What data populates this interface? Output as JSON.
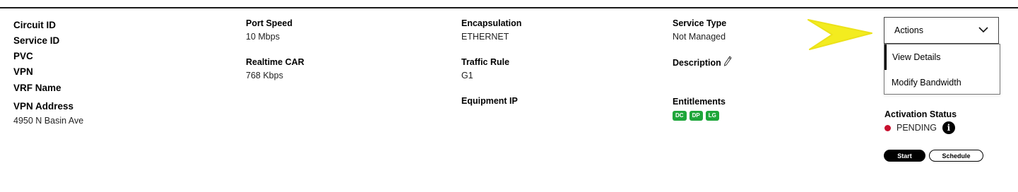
{
  "col1": {
    "circuit_id_label": "Circuit ID",
    "service_id_label": "Service ID",
    "pvc_label": "PVC",
    "vpn_label": "VPN",
    "vrf_name_label": "VRF Name",
    "vpn_address_label": "VPN Address",
    "vpn_address_value": "4950 N Basin Ave"
  },
  "col2": {
    "port_speed_label": "Port Speed",
    "port_speed_value": "10 Mbps",
    "realtime_car_label": "Realtime CAR",
    "realtime_car_value": "768 Kbps"
  },
  "col3": {
    "encapsulation_label": "Encapsulation",
    "encapsulation_value": "ETHERNET",
    "traffic_rule_label": "Traffic Rule",
    "traffic_rule_value": "G1",
    "equipment_ip_label": "Equipment IP"
  },
  "col4": {
    "service_type_label": "Service Type",
    "service_type_value": "Not Managed",
    "description_label": "Description",
    "entitlements_label": "Entitlements",
    "entitlements": [
      "DC",
      "DP",
      "LG"
    ]
  },
  "actions": {
    "label": "Actions",
    "menu": [
      "View Details",
      "Modify Bandwidth"
    ]
  },
  "activation": {
    "label": "Activation Status",
    "status": "PENDING",
    "info_glyph": "i",
    "start_label": "Start",
    "schedule_label": "Schedule"
  },
  "colors": {
    "badge_green": "#1ea63a",
    "status_red": "#c8102e",
    "arrow_yellow": "#f3ec1f"
  },
  "icons": [
    "pencil-icon",
    "chevron-down-icon",
    "info-icon",
    "yellow-arrow-annotation"
  ]
}
